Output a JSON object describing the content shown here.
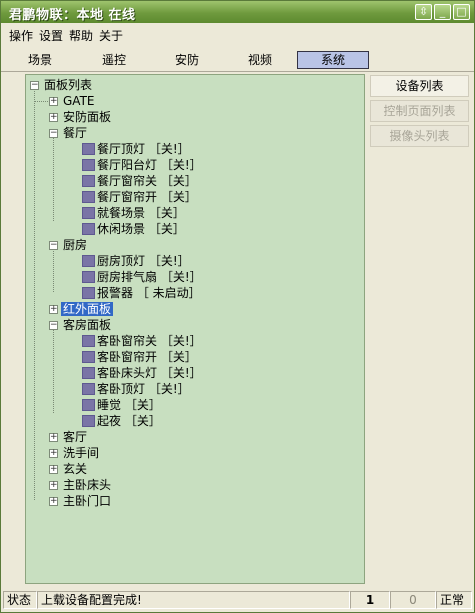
{
  "window": {
    "title": "君鹏物联：本地 在线",
    "btn_restore": "⇳",
    "btn_min": "_",
    "btn_close": "□"
  },
  "menu": [
    "操作",
    "设置",
    "帮助",
    "关于"
  ],
  "tabs": {
    "items": [
      "场景",
      "遥控",
      "安防",
      "视频",
      "系统"
    ],
    "active_index": 4
  },
  "tree": {
    "root": "面板列表",
    "gate": "GATE",
    "security_panel": "安防面板",
    "restaurant": {
      "label": "餐厅",
      "items": [
        "餐厅顶灯 ［关!］",
        "餐厅阳台灯 ［关!］",
        "餐厅窗帘关 ［关］",
        "餐厅窗帘开 ［关］",
        "就餐场景 ［关］",
        "休闲场景 ［关］"
      ]
    },
    "kitchen": {
      "label": "厨房",
      "items": [
        "厨房顶灯 ［关!］",
        "厨房排气扇 ［关!］",
        "报警器 ［  未启动］"
      ]
    },
    "ir_panel": "红外面板",
    "guest_panel": {
      "label": "客房面板",
      "items": [
        "客卧窗帘关 ［关!］",
        "客卧窗帘开 ［关］",
        "客卧床头灯 ［关!］",
        "客卧顶灯 ［关!］",
        "睡觉 ［关］",
        "起夜 ［关］"
      ]
    },
    "tail": [
      "客厅",
      "洗手间",
      "玄关",
      "主卧床头",
      "主卧门口"
    ]
  },
  "side_buttons": {
    "devices": "设备列表",
    "control_pages": "控制页面列表",
    "cameras": "摄像头列表"
  },
  "status": {
    "label": "状态",
    "message": "上载设备配置完成!",
    "count1": "1",
    "count2": "0",
    "state": "正常"
  },
  "colors": {
    "title_green": "#6f9a3e",
    "tree_bg": "#c8dfc0",
    "selection": "#3168c6"
  }
}
